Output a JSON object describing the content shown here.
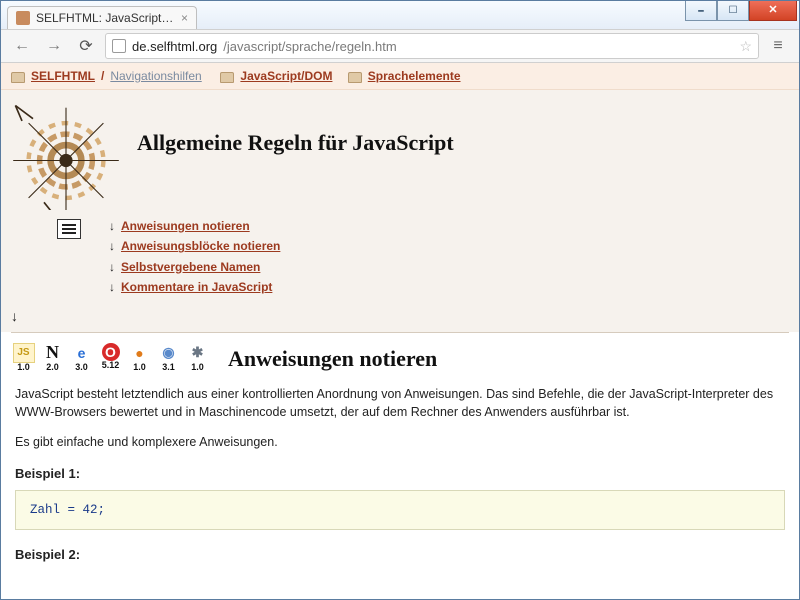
{
  "window": {
    "tab_title": "SELFHTML: JavaScript / Sp…"
  },
  "toolbar": {
    "url_host": "de.selfhtml.org",
    "url_path": "/javascript/sprache/regeln.htm"
  },
  "breadcrumbs": {
    "root": "SELFHTML",
    "navhelp": "Navigationshilfen",
    "section": "JavaScript/DOM",
    "sub": "Sprachelemente"
  },
  "header": {
    "title": "Allgemeine Regeln für JavaScript"
  },
  "toc": [
    "Anweisungen notieren",
    "Anweisungsblöcke notieren",
    "Selbstvergebene Namen",
    "Kommentare in JavaScript"
  ],
  "compat": {
    "js": "1.0",
    "netscape": "2.0",
    "ie": "3.0",
    "opera": "5.12",
    "firefox": "1.0",
    "safari_like": "3.1",
    "konq": "1.0"
  },
  "section1": {
    "title": "Anweisungen notieren",
    "p1": "JavaScript besteht letztendlich aus einer kontrollierten Anordnung von Anweisungen. Das sind Befehle, die der JavaScript-Interpreter des WWW-Browsers bewertet und in Maschinencode umsetzt, der auf dem Rechner des Anwenders ausführbar ist.",
    "p2": "Es gibt einfache und komplexere Anweisungen.",
    "ex1_label": "Beispiel 1:",
    "ex1_code": "Zahl = 42;",
    "ex2_label": "Beispiel 2:"
  }
}
